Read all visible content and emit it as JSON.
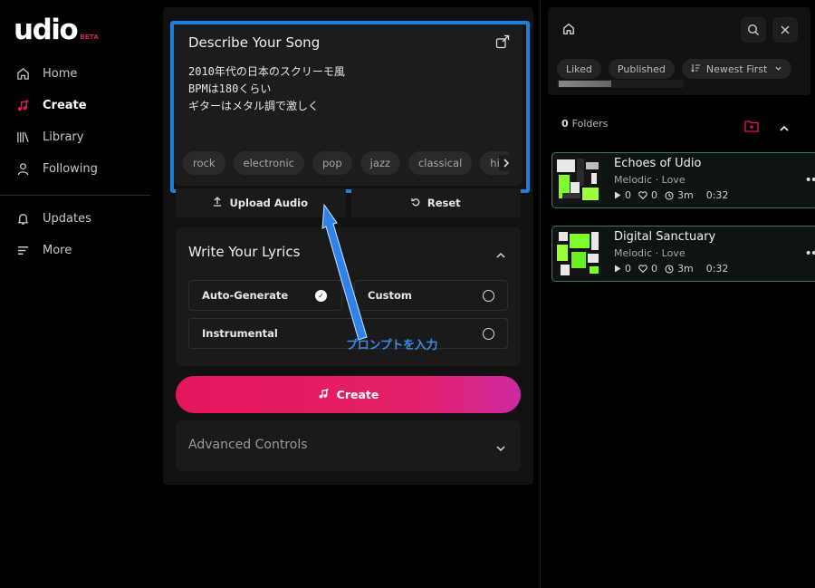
{
  "brand": {
    "logo_text": "udio",
    "badge": "BETA",
    "accent": "#e3165e"
  },
  "nav": {
    "items": [
      {
        "label": "Home",
        "icon": "home-icon",
        "active": false
      },
      {
        "label": "Create",
        "icon": "music-sparkle-icon",
        "active": true
      },
      {
        "label": "Library",
        "icon": "library-icon",
        "active": false
      },
      {
        "label": "Following",
        "icon": "user-icon",
        "active": false
      }
    ],
    "secondary": [
      {
        "label": "Updates",
        "icon": "bell-icon"
      },
      {
        "label": "More",
        "icon": "menu-icon"
      }
    ]
  },
  "describe": {
    "title": "Describe Your Song",
    "prompt_lines": [
      "2010年代の日本のスクリーモ風",
      "BPMは180くらい",
      "ギターはメタル調で激しく"
    ],
    "tags": [
      "rock",
      "electronic",
      "pop",
      "jazz",
      "classical",
      "hip"
    ]
  },
  "actions": {
    "upload": "Upload Audio",
    "reset": "Reset"
  },
  "lyrics": {
    "title": "Write Your Lyrics",
    "options": [
      "Auto-Generate",
      "Custom",
      "Instrumental"
    ],
    "selected": "Auto-Generate"
  },
  "annotation": {
    "text": "プロンプトを入力",
    "color": "#1d7fe0"
  },
  "create_label": "Create",
  "advanced_label": "Advanced Controls",
  "right": {
    "filters": [
      "Liked",
      "Published"
    ],
    "sort": "Newest First",
    "folders_count": "0",
    "folders_label": "Folders"
  },
  "songs": [
    {
      "title": "Echoes of Udio",
      "genre": "Melodic",
      "mood": "Love",
      "plays": "0",
      "likes": "0",
      "age": "3m",
      "duration": "0:32"
    },
    {
      "title": "Digital Sanctuary",
      "genre": "Melodic",
      "mood": "Love",
      "plays": "0",
      "likes": "0",
      "age": "3m",
      "duration": "0:32"
    }
  ]
}
